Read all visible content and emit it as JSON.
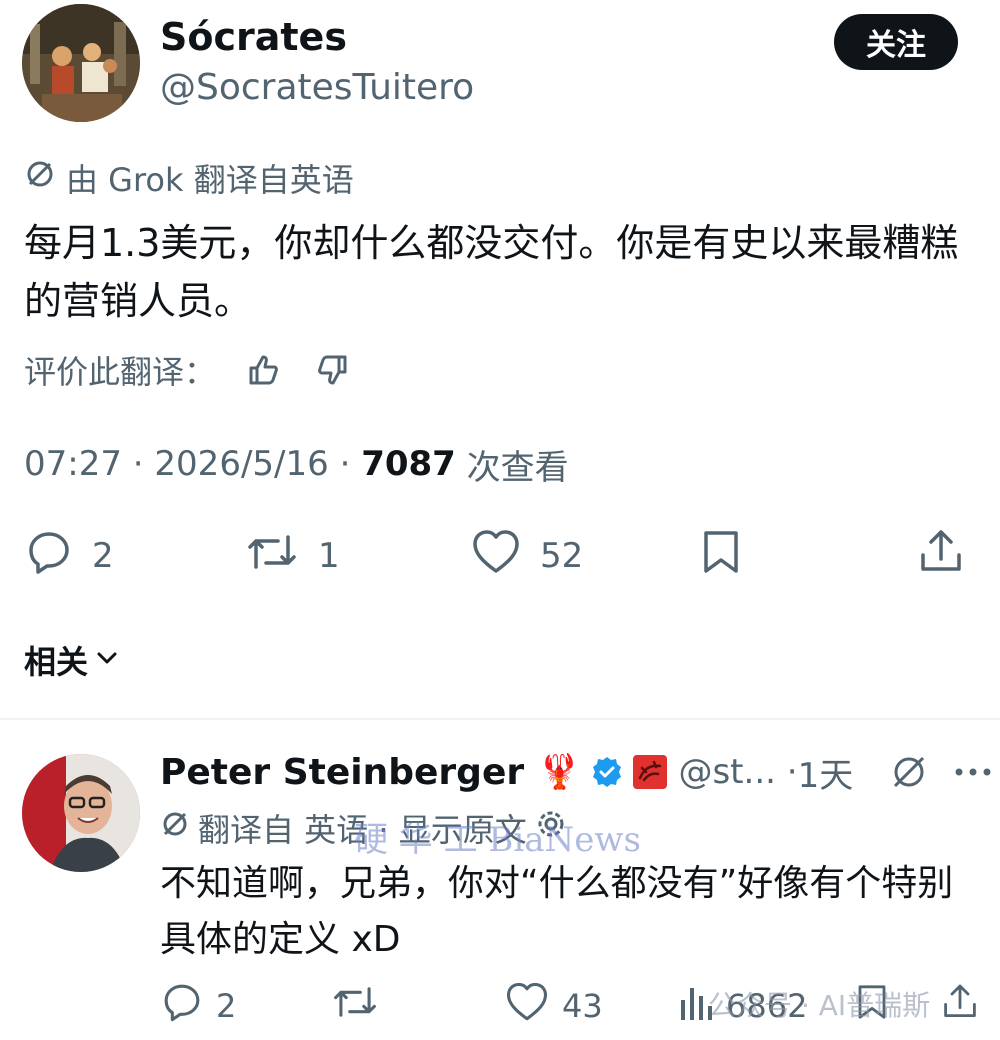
{
  "main_tweet": {
    "author_name": "Sócrates",
    "author_handle": "@SocratesTuitero",
    "follow_label": "关注",
    "translation_note": "由 Grok 翻译自英语",
    "body": "每月1.3美元，你却什么都没交付。你是有史以来最糟糕的营销人员。",
    "rate_label": "评价此翻译：",
    "time": "07:27",
    "date": "2026/5/16",
    "views_count": "7087",
    "views_label": "次查看",
    "replies": "2",
    "reposts": "1",
    "likes": "52"
  },
  "related": {
    "label": "相关"
  },
  "reply": {
    "author_name": "Peter Steinberger",
    "emoji": "🦞",
    "handle": "@st...",
    "time_ago": "1天",
    "translation_note": "翻译自 英语 · 显示原文",
    "body": "不知道啊，兄弟，你对“什么都没有”好像有个特别具体的定义 xD",
    "replies": "2",
    "likes": "43",
    "views": "6862"
  },
  "watermarks": {
    "center": "硬 华 工 BiaNews",
    "bottom": "公众号 · AI普瑞斯"
  },
  "colors": {
    "text": "#0f1419",
    "muted": "#536471",
    "verified": "#1d9bf0",
    "divider": "#eff3f4"
  }
}
